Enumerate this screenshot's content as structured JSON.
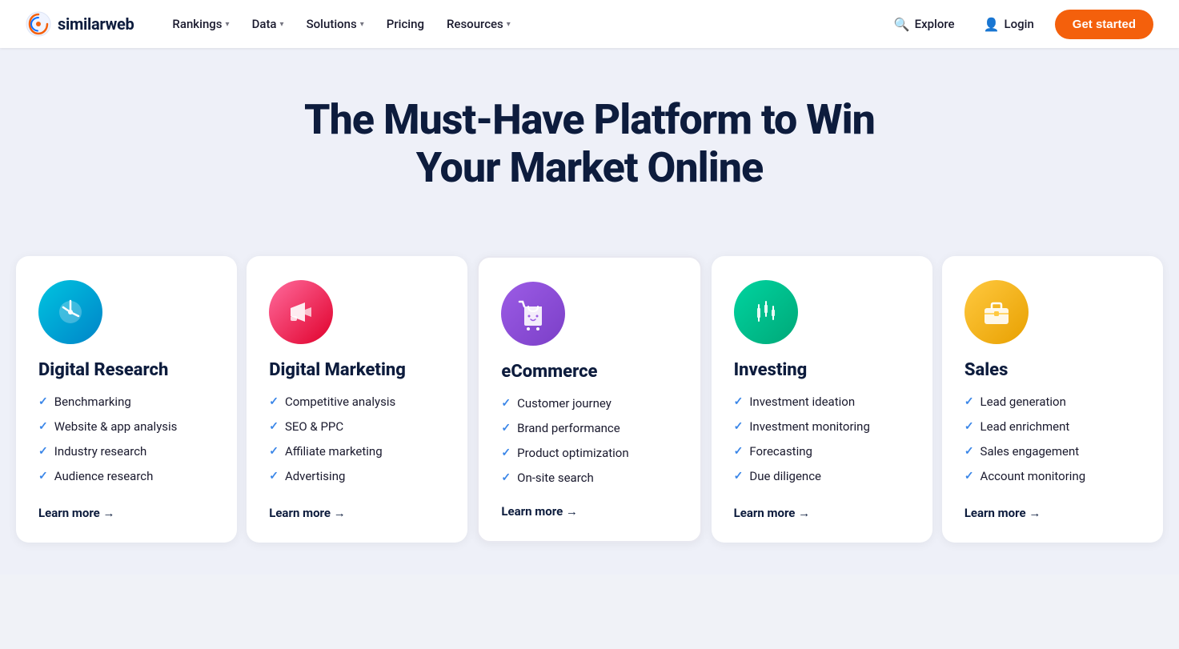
{
  "brand": {
    "name": "similarweb",
    "logo_alt": "Similarweb logo"
  },
  "nav": {
    "links": [
      {
        "label": "Rankings",
        "has_dropdown": true
      },
      {
        "label": "Data",
        "has_dropdown": true
      },
      {
        "label": "Solutions",
        "has_dropdown": true
      },
      {
        "label": "Pricing",
        "has_dropdown": false
      },
      {
        "label": "Resources",
        "has_dropdown": true
      }
    ],
    "explore_label": "Explore",
    "login_label": "Login",
    "cta_label": "Get started"
  },
  "hero": {
    "title": "The Must-Have Platform to Win Your Market Online"
  },
  "cards": [
    {
      "id": "digital-research",
      "title": "Digital Research",
      "icon_type": "chart",
      "items": [
        "Benchmarking",
        "Website & app analysis",
        "Industry research",
        "Audience research"
      ],
      "learn_more": "Learn more →"
    },
    {
      "id": "digital-marketing",
      "title": "Digital Marketing",
      "icon_type": "megaphone",
      "items": [
        "Competitive analysis",
        "SEO & PPC",
        "Affiliate marketing",
        "Advertising"
      ],
      "learn_more": "Learn more →"
    },
    {
      "id": "ecommerce",
      "title": "eCommerce",
      "icon_type": "shopping",
      "items": [
        "Customer journey",
        "Brand performance",
        "Product optimization",
        "On-site search"
      ],
      "learn_more": "Learn more →",
      "highlighted": true
    },
    {
      "id": "investing",
      "title": "Investing",
      "icon_type": "candlestick",
      "items": [
        "Investment ideation",
        "Investment monitoring",
        "Forecasting",
        "Due diligence"
      ],
      "learn_more": "Learn more →"
    },
    {
      "id": "sales",
      "title": "Sales",
      "icon_type": "briefcase",
      "items": [
        "Lead generation",
        "Lead enrichment",
        "Sales engagement",
        "Account monitoring"
      ],
      "learn_more": "Learn more →"
    }
  ]
}
